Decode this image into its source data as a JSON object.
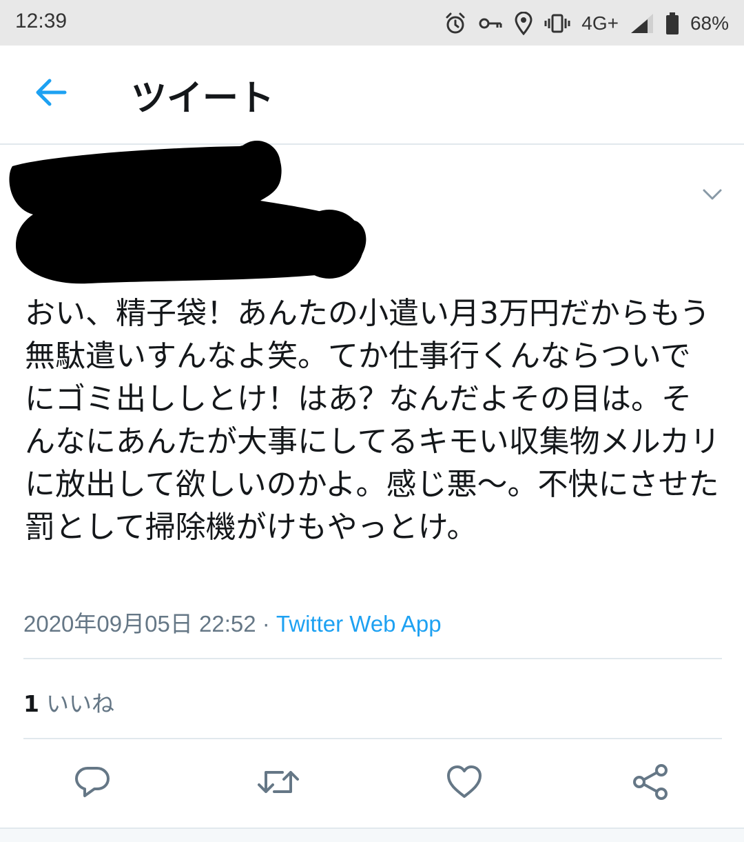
{
  "status_bar": {
    "time": "12:39",
    "network": "4G+",
    "battery": "68%",
    "icons": [
      "alarm-icon",
      "vpn-key-icon",
      "location-icon",
      "vibrate-icon",
      "signal-icon",
      "battery-icon"
    ]
  },
  "header": {
    "title": "ツイート",
    "back_icon": "arrow-left-icon"
  },
  "tweet": {
    "text": "おい、精子袋！あんたの小遣い月3万円だからもう無駄遣いすんなよ笑。てか仕事行くんならついでにゴミ出ししとけ！はあ？なんだよその目は。そんなにあんたが大事にしてるキモい収集物メルカリに放出して欲しいのかよ。感じ悪〜。不快にさせた罰として掃除機がけもやっとけ。",
    "timestamp": "2020年09月05日 22:52",
    "separator": "·",
    "source": "Twitter Web App",
    "likes_count": "1",
    "likes_label": "いいね"
  },
  "actions": [
    "reply-icon",
    "retweet-icon",
    "like-icon",
    "share-icon"
  ],
  "colors": {
    "accent": "#1da1f2",
    "text": "#14171a",
    "secondary": "#657786",
    "divider": "#e1e8ed",
    "status_bar": "#e8e8e8"
  }
}
